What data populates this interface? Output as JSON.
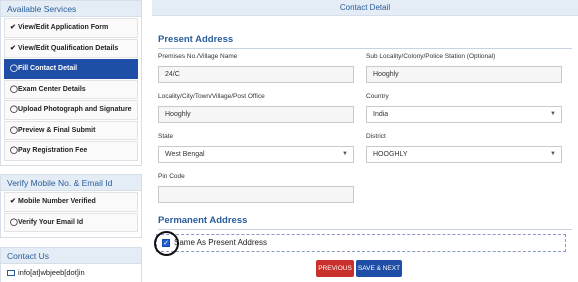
{
  "sidebar": {
    "services_title": "Available Services",
    "items": [
      {
        "label": "View/Edit Application Form"
      },
      {
        "label": "View/Edit Qualification Details"
      },
      {
        "label": "Fill Contact Detail"
      },
      {
        "label": "Exam Center Details"
      },
      {
        "label": "Upload Photograph and Signature"
      },
      {
        "label": "Preview & Final Submit"
      },
      {
        "label": "Pay Registration Fee"
      }
    ],
    "verify_title": "Verify Mobile No. & Email Id",
    "verify_items": [
      {
        "label": "Mobile Number Verified"
      },
      {
        "label": "Verify Your Email Id"
      }
    ],
    "contact_title": "Contact Us",
    "contact_email": "info[at]wbjeeb[dot]in"
  },
  "main": {
    "header": "Contact Detail",
    "present_title": "Present Address",
    "premises_label": "Premises No./Village Name",
    "premises_value": "24/C",
    "sublocality_label": "Sub Locality/Colony/Police Station (Optional)",
    "sublocality_value": "Hooghly",
    "city_label": "Locality/City/Town/Village/Post Office",
    "city_value": "Hooghly",
    "country_label": "Country",
    "country_value": "India",
    "state_label": "State",
    "state_value": "West Bengal",
    "district_label": "District",
    "district_value": "HOOGHLY",
    "pincode_label": "Pin Code",
    "pincode_value": "",
    "permanent_title": "Permanent Address",
    "same_as_label": "Same As Present Address",
    "same_as_checked": true,
    "previous_label": "PREVIOUS",
    "save_next_label": "SAVE & NEXT"
  },
  "colors": {
    "accent": "#1f4ea6",
    "header_bg": "#e4ecf5",
    "title_text": "#2a5d9c",
    "previous_btn": "#c9302c"
  }
}
